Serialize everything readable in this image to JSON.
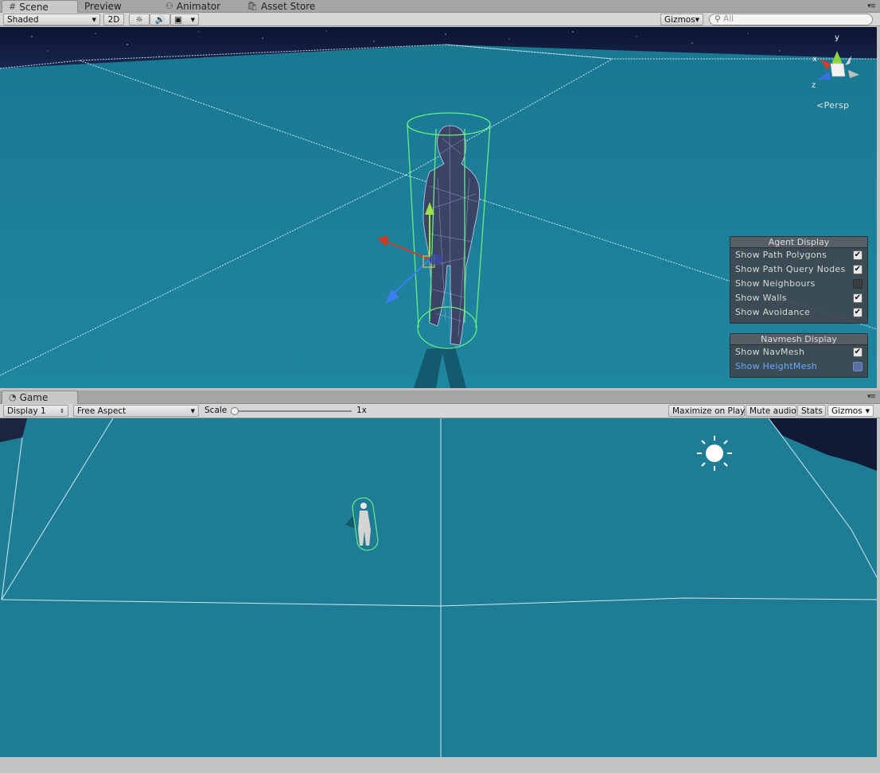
{
  "top_tabs": [
    {
      "label": "Scene",
      "icon": "scene-hash-icon",
      "active": true
    },
    {
      "label": "Preview",
      "icon": "",
      "active": false
    },
    {
      "label": "Animator",
      "icon": "animator-icon",
      "active": false
    },
    {
      "label": "Asset Store",
      "icon": "store-icon",
      "active": false
    }
  ],
  "scene_toolbar": {
    "draw_mode": "Shaded",
    "mode_2d": "2D",
    "gizmos": "Gizmos",
    "search_placeholder": "All"
  },
  "scene_view": {
    "axis_labels": {
      "y": "y",
      "x": "x",
      "z": "z"
    },
    "projection": "Persp",
    "colors": {
      "ground": "#1e7e96",
      "sky": "#101834",
      "navmesh_lines": "#d8f4ff",
      "capsule": "#5fe87a"
    }
  },
  "agent_display": {
    "title": "Agent Display",
    "items": [
      {
        "label": "Show Path Polygons",
        "checked": true
      },
      {
        "label": "Show Path Query Nodes",
        "checked": true
      },
      {
        "label": "Show Neighbours",
        "checked": false
      },
      {
        "label": "Show Walls",
        "checked": true
      },
      {
        "label": "Show Avoidance",
        "checked": true
      }
    ]
  },
  "navmesh_display": {
    "title": "Navmesh Display",
    "items": [
      {
        "label": "Show NavMesh",
        "checked": true,
        "highlighted": false
      },
      {
        "label": "Show HeightMesh",
        "checked": false,
        "highlighted": true
      }
    ]
  },
  "game_tab": {
    "label": "Game",
    "icon": "game-pacman-icon"
  },
  "game_toolbar": {
    "display": "Display 1",
    "aspect": "Free Aspect",
    "scale_label": "Scale",
    "scale_value": "1x",
    "scale_fraction": 0.0,
    "maximize": "Maximize on Play",
    "mute": "Mute audio",
    "stats": "Stats",
    "gizmos": "Gizmos"
  }
}
